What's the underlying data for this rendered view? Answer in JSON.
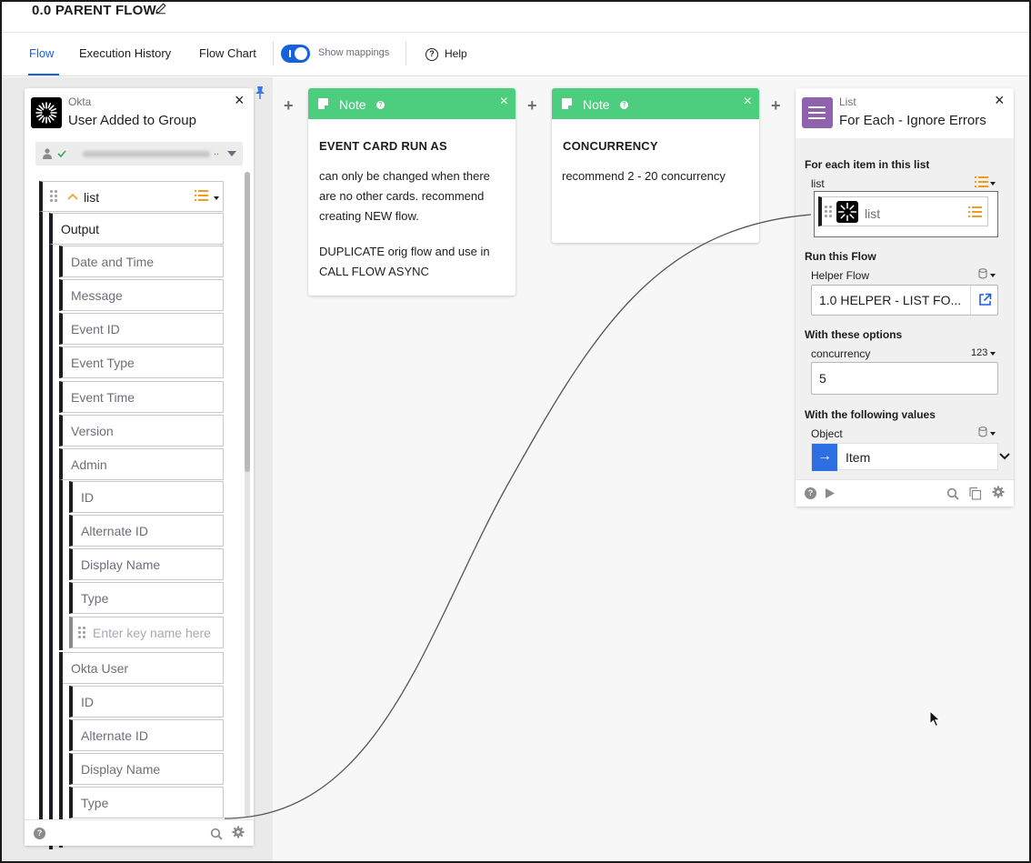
{
  "header": {
    "title": "0.0 PARENT FLOW",
    "edit_icon": "pencil-icon"
  },
  "tabs": [
    {
      "label": "Flow",
      "active": true
    },
    {
      "label": "Execution History",
      "active": false
    },
    {
      "label": "Flow Chart",
      "active": false
    }
  ],
  "toolbar": {
    "show_mappings_label": "Show mappings",
    "show_mappings_on": true,
    "help_label": "Help"
  },
  "colors": {
    "accent": "#1662dd",
    "note_green": "#4cce7e",
    "list_purple": "#8f62ad",
    "item_blue": "#2d6fe3",
    "list_orange": "#f29a21"
  },
  "event_card": {
    "app": "Okta",
    "title": "User Added to Group",
    "connection_dots": "..",
    "root_field": "list",
    "fields": {
      "output": "Output",
      "date_time": "Date and Time",
      "message": "Message",
      "event_id": "Event ID",
      "event_type": "Event Type",
      "event_time": "Event Time",
      "version": "Version",
      "admin": "Admin",
      "admin_children": [
        "ID",
        "Alternate ID",
        "Display Name",
        "Type"
      ],
      "key_placeholder": "Enter key name here",
      "okta_user": "Okta User",
      "okta_user_children": [
        "ID",
        "Alternate ID",
        "Display Name",
        "Type"
      ]
    }
  },
  "notes": [
    {
      "label": "Note",
      "title": "EVENT CARD RUN AS",
      "paragraphs": [
        "can only be changed when there are no other cards. recommend creating NEW flow.",
        "DUPLICATE orig flow and use in CALL FLOW ASYNC"
      ]
    },
    {
      "label": "Note",
      "title": "CONCURRENCY",
      "paragraphs": [
        "recommend 2 - 20 concurrency"
      ]
    }
  ],
  "list_card": {
    "app": "List",
    "title": "For Each - Ignore Errors",
    "section_list": "For each item in this list",
    "list_label": "list",
    "list_chip": "list",
    "section_flow": "Run this Flow",
    "helper_label": "Helper Flow",
    "helper_value": "1.0 HELPER - LIST FO...",
    "section_options": "With these options",
    "concurrency_label": "concurrency",
    "concurrency_type": "123",
    "concurrency_value": "5",
    "section_values": "With the following values",
    "object_label": "Object",
    "item_label": "Item"
  }
}
